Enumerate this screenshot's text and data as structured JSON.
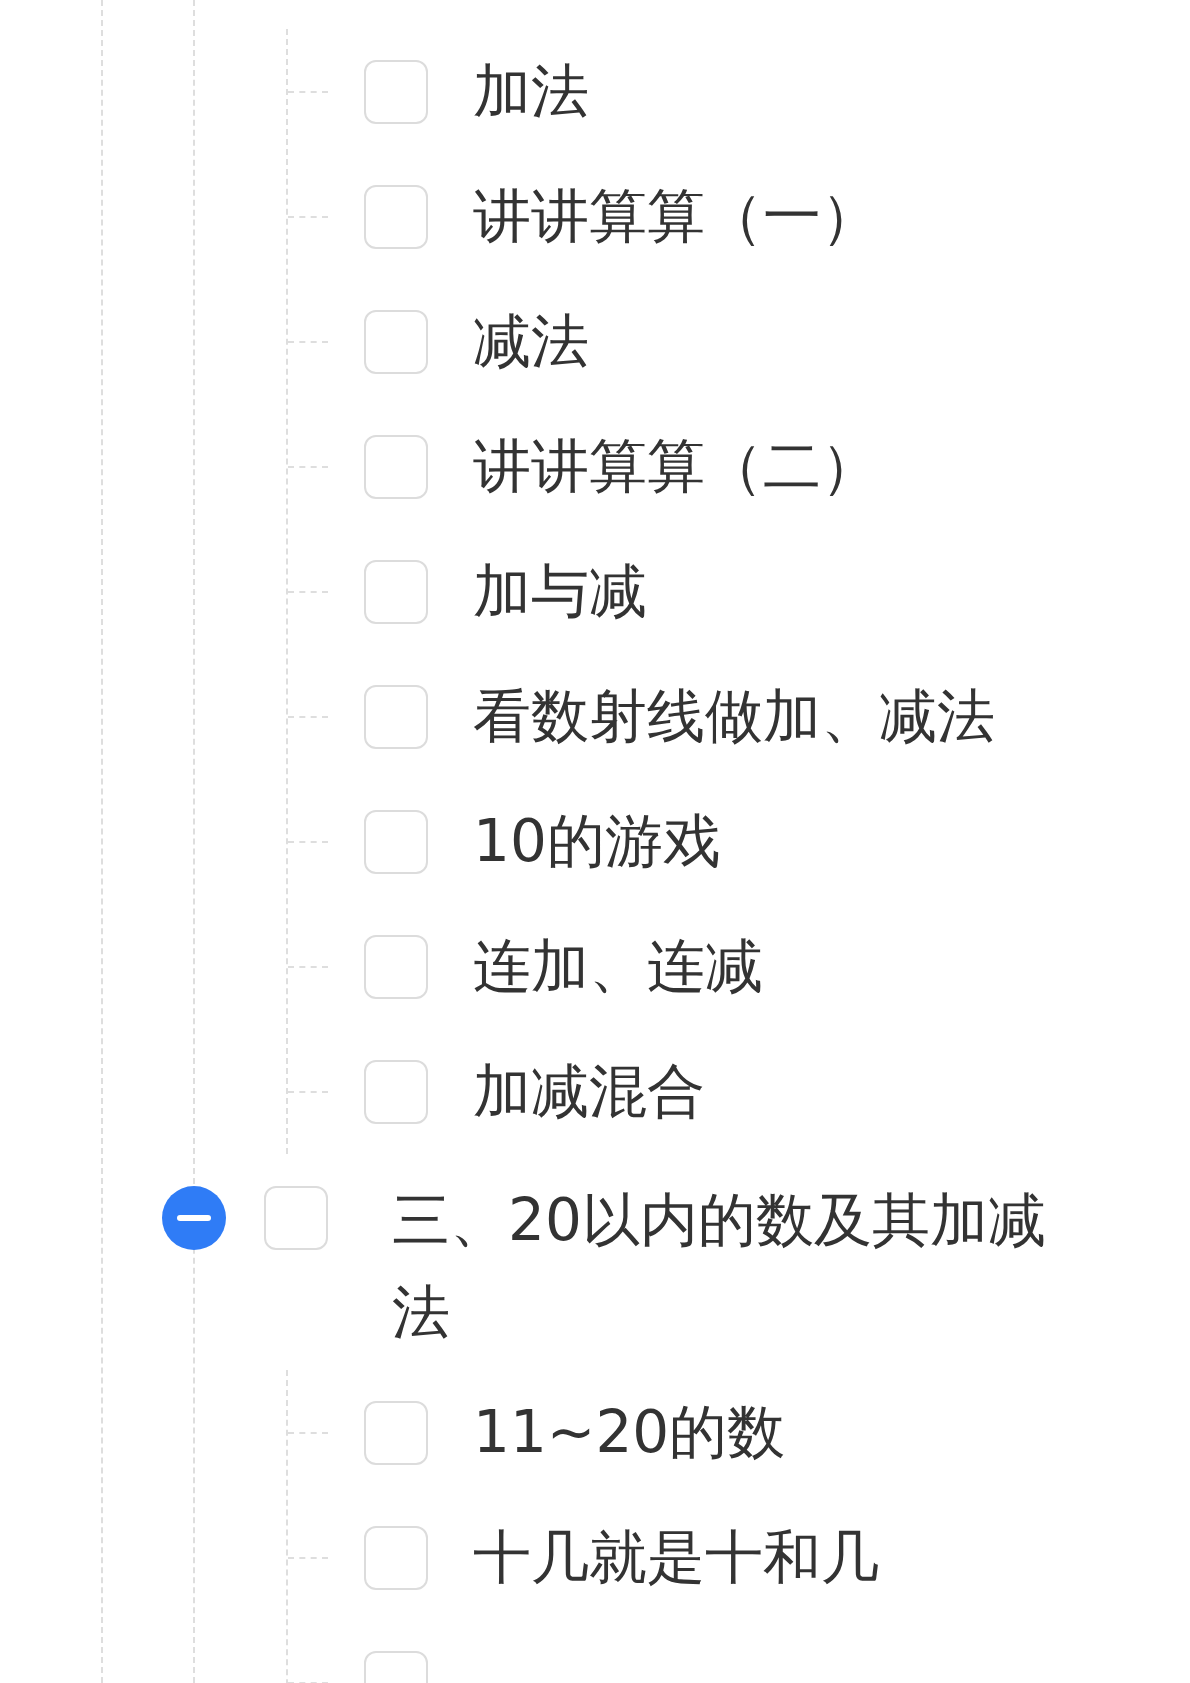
{
  "sections": [
    {
      "children": [
        {
          "label": "加法",
          "checked": false
        },
        {
          "label": "讲讲算算（一）",
          "checked": false
        },
        {
          "label": "减法",
          "checked": false
        },
        {
          "label": "讲讲算算（二）",
          "checked": false
        },
        {
          "label": "加与减",
          "checked": false
        },
        {
          "label": "看数射线做加、减法",
          "checked": false
        },
        {
          "label": "10的游戏",
          "checked": false
        },
        {
          "label": "连加、连减",
          "checked": false
        },
        {
          "label": "加减混合",
          "checked": false
        }
      ]
    },
    {
      "label": "三、20以内的数及其加减法",
      "expanded": true,
      "checked": false,
      "children": [
        {
          "label": "11~20的数",
          "checked": false
        },
        {
          "label": "十几就是十和几",
          "checked": false
        },
        {
          "checked": false
        }
      ]
    }
  ]
}
